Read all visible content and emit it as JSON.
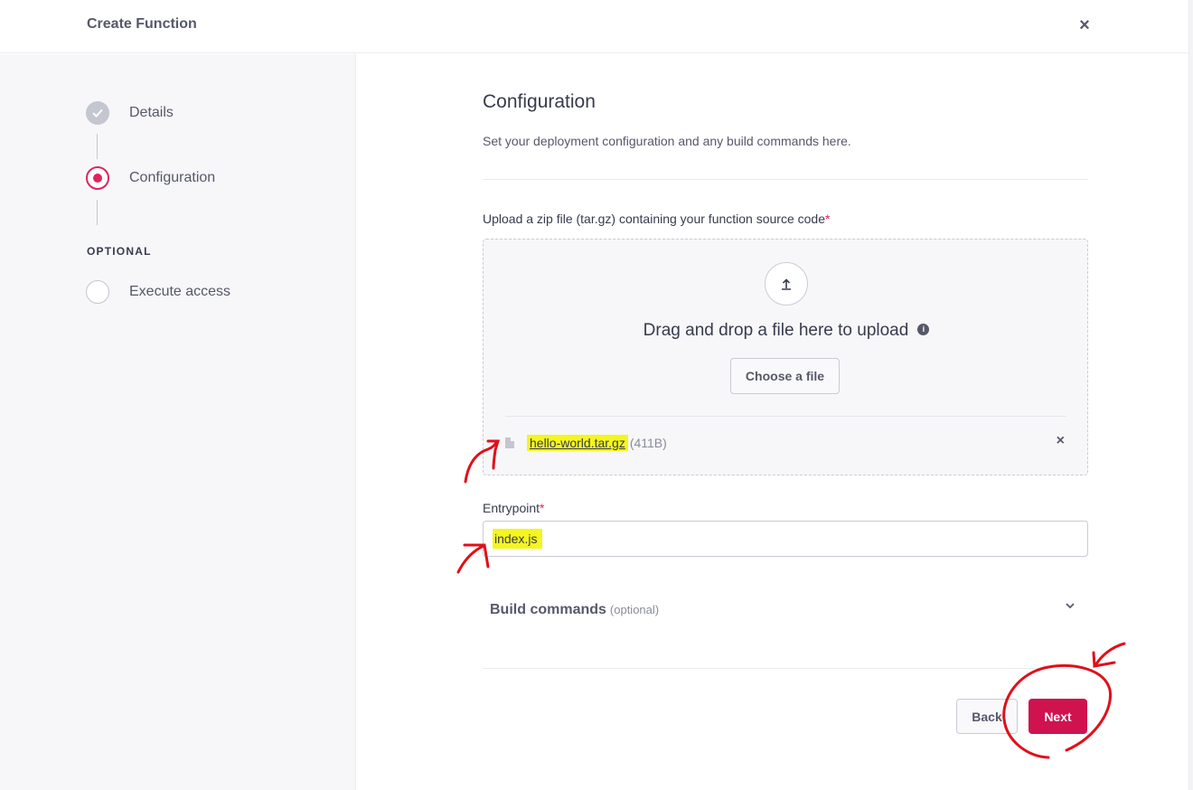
{
  "header": {
    "title": "Create Function",
    "close_icon": "×"
  },
  "sidebar": {
    "steps": [
      {
        "label": "Details",
        "state": "completed"
      },
      {
        "label": "Configuration",
        "state": "active"
      },
      {
        "label": "Execute access",
        "state": "pending"
      }
    ],
    "optional_label": "OPTIONAL"
  },
  "main": {
    "title": "Configuration",
    "subtitle": "Set your deployment configuration and any build commands here.",
    "upload": {
      "label": "Upload a zip file (tar.gz) containing your function source code",
      "required_mark": "*",
      "dropzone_text": "Drag and drop a file here to upload",
      "choose_button": "Choose a file",
      "file": {
        "name": "hello-world.tar.gz",
        "size": "(411B)"
      }
    },
    "entrypoint": {
      "label": "Entrypoint",
      "required_mark": "*",
      "value": "index.js"
    },
    "build": {
      "title": "Build commands",
      "optional": "(optional)"
    },
    "buttons": {
      "back": "Back",
      "next": "Next"
    }
  },
  "colors": {
    "accent": "#d0124f",
    "highlight": "#f5f51f",
    "annotation": "#e0101a"
  }
}
